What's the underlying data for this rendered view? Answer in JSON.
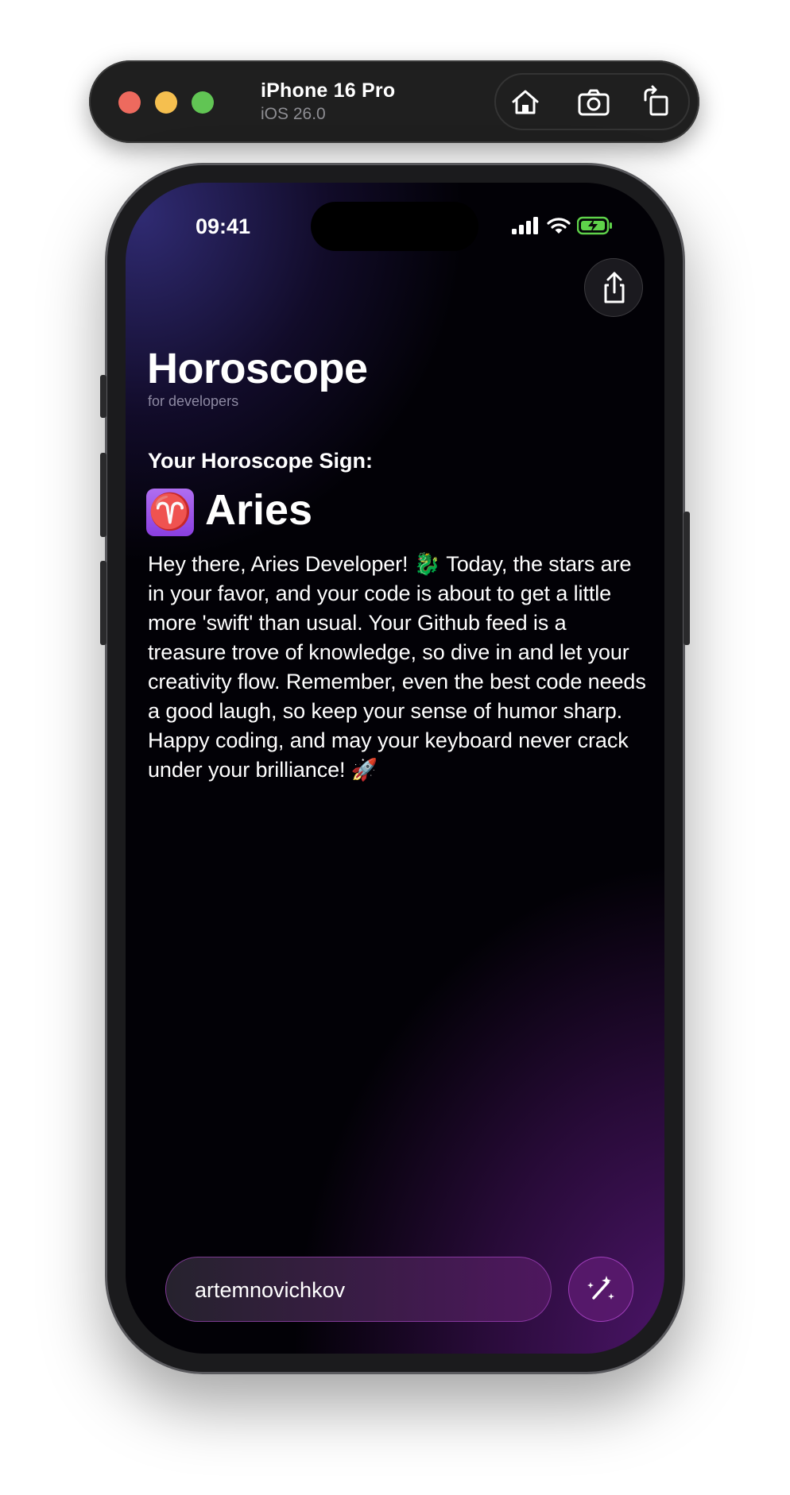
{
  "simulator": {
    "device_name": "iPhone 16 Pro",
    "os_version": "iOS 26.0",
    "toolbar_icons": [
      "home-icon",
      "screenshot-icon",
      "rotate-icon"
    ]
  },
  "status_bar": {
    "time": "09:41",
    "icons": [
      "cellular-signal-icon",
      "wifi-icon",
      "battery-charging-icon"
    ]
  },
  "header": {
    "share_icon": "share-icon"
  },
  "app": {
    "title": "Horoscope",
    "subtitle": "for developers",
    "sign_label": "Your Horoscope Sign:",
    "sign_symbol": "♈",
    "sign_name": "Aries",
    "message": "Hey there, Aries Developer! 🐉 Today, the stars are in your favor, and your code is about to get a little more 'swift' than usual. Your Github feed is a treasure trove of knowledge, so dive in and let your creativity flow. Remember, even the best code needs a good laugh, so keep your sense of humor sharp. Happy coding, and may your keyboard never crack under your brilliance! 🚀"
  },
  "input": {
    "username_value": "artemnovichkov",
    "generate_icon": "magic-wand-icon"
  },
  "colors": {
    "accent": "#b048d8",
    "sign_badge": "#9b4fe8",
    "traffic_red": "#ed6a5e",
    "traffic_yellow": "#f5bf4f",
    "traffic_green": "#61c554",
    "battery": "#5fd24a"
  }
}
